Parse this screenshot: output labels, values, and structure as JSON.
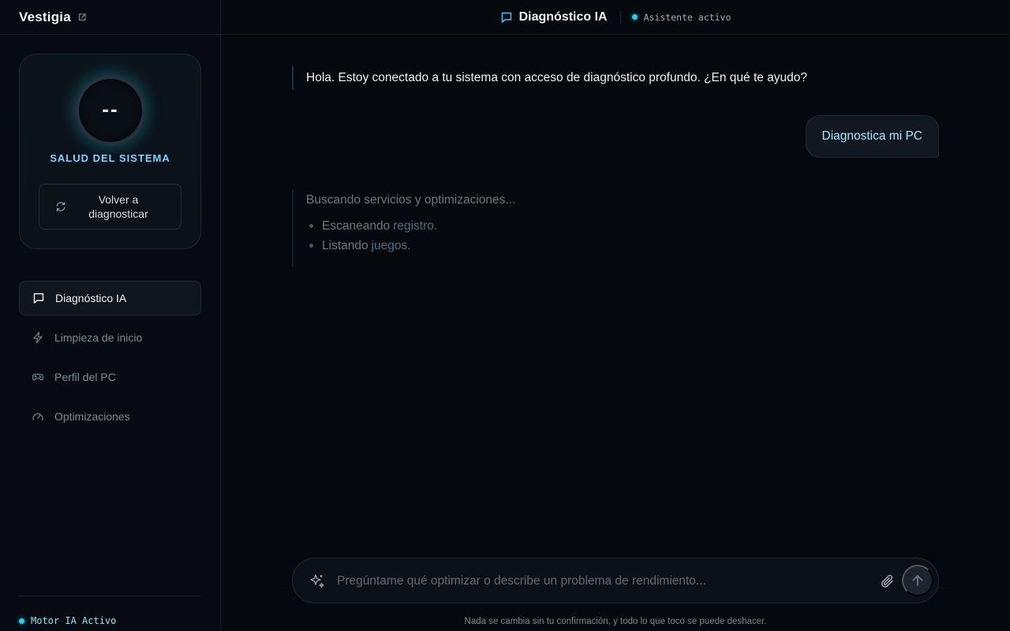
{
  "brand": {
    "name": "Vestigia",
    "icon": "external-link-icon"
  },
  "health": {
    "value": "--",
    "label": "SALUD DEL SISTEMA",
    "rediagnose_label": "Volver a diagnosticar",
    "rediagnose_icon": "refresh-icon"
  },
  "nav": [
    {
      "label": "Diagnóstico IA",
      "icon": "chat-icon",
      "active": true
    },
    {
      "label": "Limpieza de inicio",
      "icon": "lightning-icon",
      "active": false
    },
    {
      "label": "Perfil del PC",
      "icon": "gamepad-icon",
      "active": false
    },
    {
      "label": "Optimizaciones",
      "icon": "gauge-icon",
      "active": false
    }
  ],
  "engine_status": "Motor IA Activo",
  "header": {
    "title": "Diagnóstico IA",
    "status": "Asistente activo"
  },
  "chat": {
    "ai_greeting": "Hola. Estoy conectado a tu sistema con acceso de diagnóstico profundo. ¿En qué te ayudo?",
    "user_message": "Diagnostica mi PC",
    "thinking_title": "Buscando servicios y optimizaciones...",
    "steps": [
      {
        "text": "Escaneando",
        "highlight": "registro."
      },
      {
        "text": "Listando",
        "highlight": "juegos."
      }
    ]
  },
  "composer": {
    "placeholder": "Pregúntame qué optimizar o describe un problema de rendimiento...",
    "footnote": "Nada se cambia sin tu confirmación, y todo lo que toco se puede deshacer."
  },
  "colors": {
    "accent": "#22d3ee",
    "background": "#05080d"
  }
}
